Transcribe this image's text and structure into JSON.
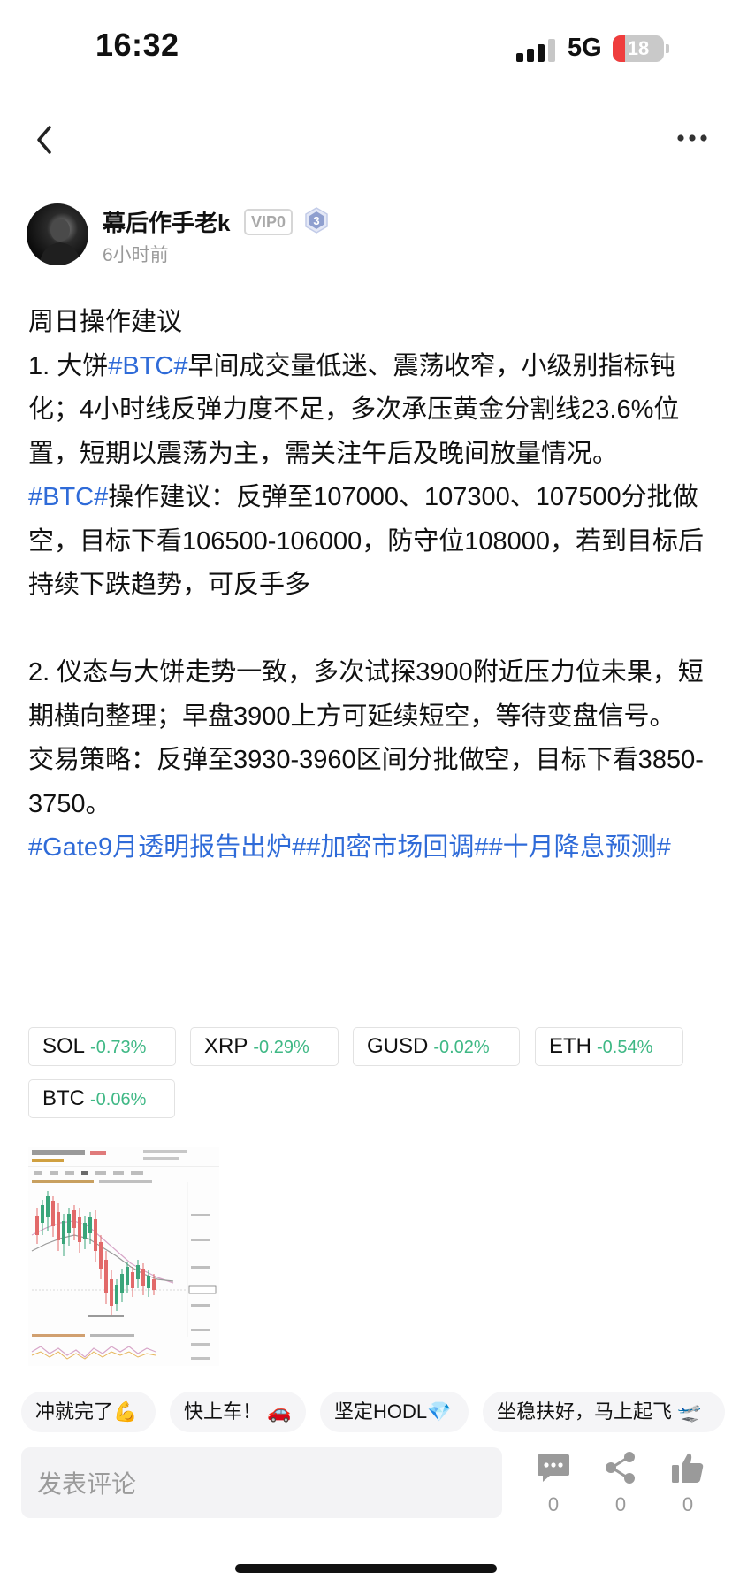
{
  "status_bar": {
    "time": "16:32",
    "network": "5G",
    "battery": "18"
  },
  "author": {
    "name": "幕后作手老k",
    "vip_badge": "VIP0",
    "level_badge": "3",
    "time_ago": "6小时前"
  },
  "post": {
    "title": "周日操作建议",
    "p1_lead": "1. 大饼",
    "p1_tag": "#BTC#",
    "p1_text": "早间成交量低迷、震荡收窄，小级别指标钝化；4小时线反弹力度不足，多次承压黄金分割线23.6%位置，短期以震荡为主，需关注午后及晚间放量情况。",
    "p2_tag": "#BTC#",
    "p2_text": "操作建议：反弹至107000、107300、107500分批做空，目标下看106500-106000，防守位108000，若到目标后持续下跌趋势，可反手多",
    "p3_text": "2. 仪态与大饼走势一致，多次试探3900附近压力位未果，短期横向整理；早盘3900上方可延续短空，等待变盘信号。",
    "p4_text": "交易策略：反弹至3930-3960区间分批做空，目标下看3850-3750。",
    "tags": [
      "#Gate9月透明报告出炉#",
      "#加密市场回调#",
      "#十月降息预测#"
    ]
  },
  "coins": [
    {
      "symbol": "SOL",
      "change": "-0.73%"
    },
    {
      "symbol": "XRP",
      "change": "-0.29%"
    },
    {
      "symbol": "GUSD",
      "change": "-0.02%"
    },
    {
      "symbol": "ETH",
      "change": "-0.54%"
    },
    {
      "symbol": "BTC",
      "change": "-0.06%"
    }
  ],
  "reactions": [
    "冲就完了💪",
    "快上车！ 🚗",
    "坚定HODL💎",
    "坐稳扶好，马上起飞 🛫"
  ],
  "comment": {
    "placeholder": "发表评论"
  },
  "actions": {
    "comments": "0",
    "shares": "0",
    "likes": "0"
  },
  "colors": {
    "hashtag": "#2f6bd8",
    "negative_change": "#3fb885"
  }
}
